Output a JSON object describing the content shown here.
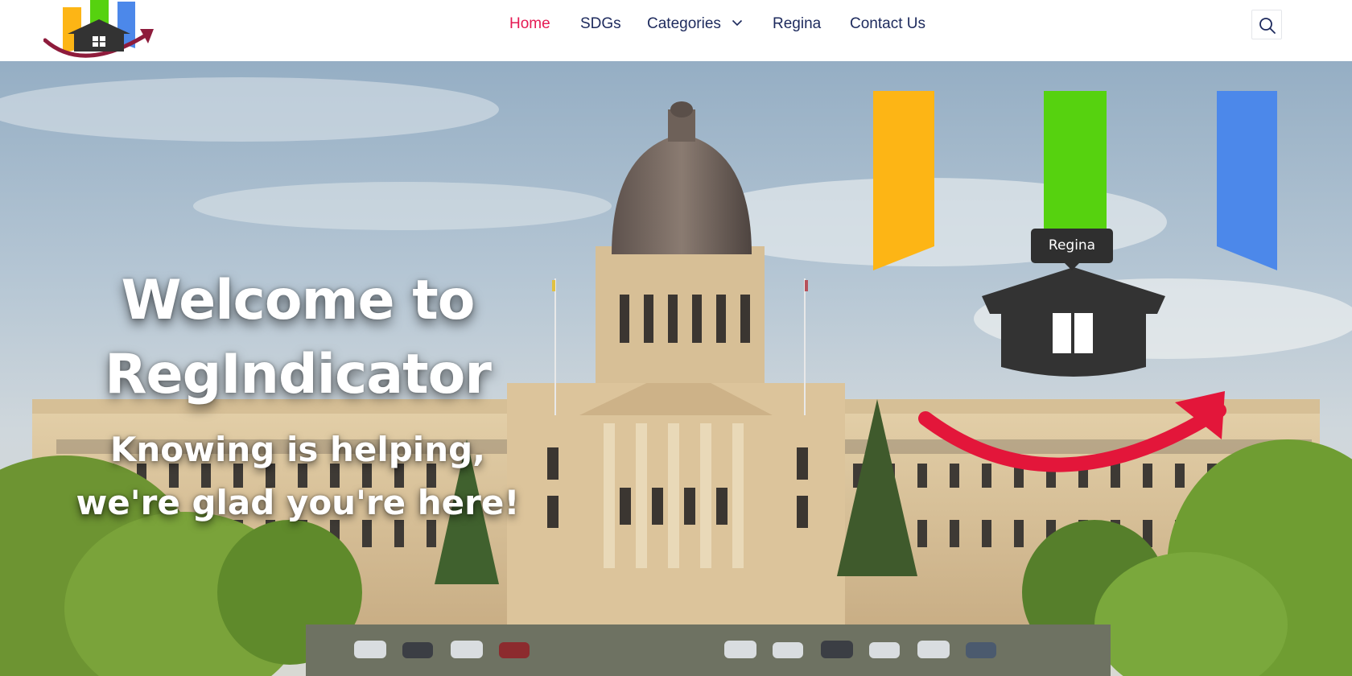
{
  "header": {
    "logo_alt": "RegIndicator logo",
    "nav": [
      {
        "label": "Home",
        "active": true
      },
      {
        "label": "SDGs",
        "active": false
      },
      {
        "label": "Categories",
        "active": false,
        "has_dropdown": true
      },
      {
        "label": "Regina",
        "active": false
      },
      {
        "label": "Contact Us",
        "active": false
      }
    ],
    "search_icon": "search-icon"
  },
  "hero": {
    "title_line1": "Welcome to",
    "title_line2": "RegIndicator",
    "subtitle_line1": "Knowing is helping,",
    "subtitle_line2": "we're glad you're here!",
    "tooltip_label": "Regina"
  },
  "colors": {
    "nav_text": "#1d2a5d",
    "nav_active": "#e51b54",
    "bar_orange": "#fdb515",
    "bar_green": "#56d20f",
    "bar_blue": "#4c88ea",
    "house": "#333333",
    "arrow": "#e3163a"
  }
}
